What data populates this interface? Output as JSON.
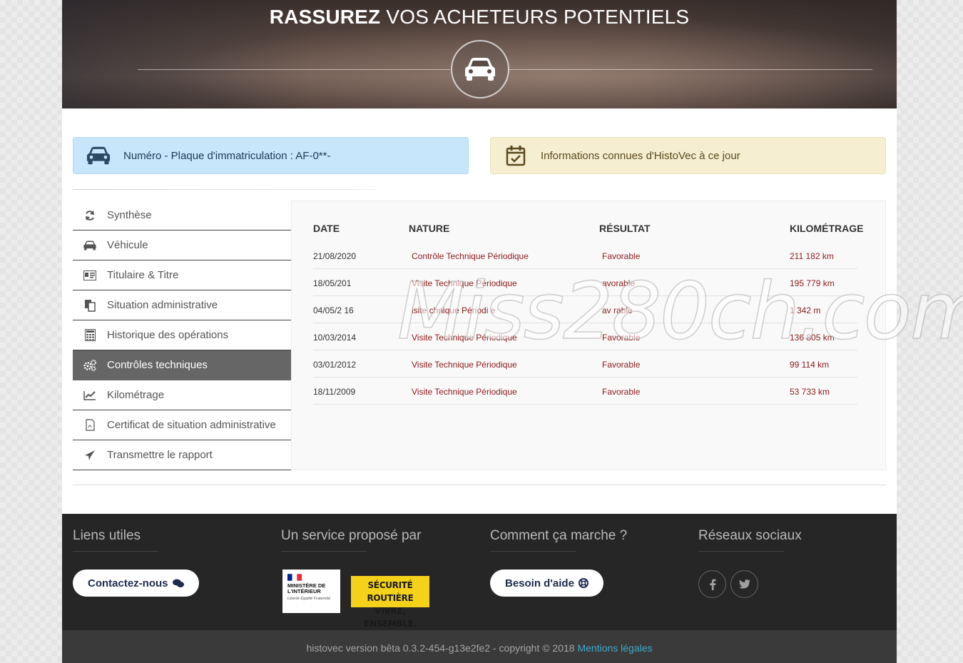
{
  "hero": {
    "title_bold": "RASSUREZ",
    "title_rest": "VOS ACHETEURS POTENTIELS"
  },
  "banners": {
    "plate": "Numéro - Plaque d'immatriculation : AF-0**-",
    "info": "Informations connues d'HistoVec à ce jour"
  },
  "menu": {
    "items": [
      {
        "label": "Synthèse",
        "icon": "refresh-icon"
      },
      {
        "label": "Véhicule",
        "icon": "car-icon"
      },
      {
        "label": "Titulaire & Titre",
        "icon": "id-card-icon"
      },
      {
        "label": "Situation administrative",
        "icon": "copy-icon"
      },
      {
        "label": "Historique des opérations",
        "icon": "calculator-icon"
      },
      {
        "label": "Contrôles techniques",
        "icon": "cogs-icon",
        "active": true
      },
      {
        "label": "Kilométrage",
        "icon": "line-chart-icon"
      },
      {
        "label": "Certificat de situation administrative",
        "icon": "pdf-icon"
      },
      {
        "label": "Transmettre le rapport",
        "icon": "send-icon"
      }
    ]
  },
  "table": {
    "headers": {
      "date": "DATE",
      "nature": "NATURE",
      "result": "RÉSULTAT",
      "km": "KILOMÉTRAGE"
    },
    "rows": [
      {
        "date": "21/08/2020",
        "nature": "Contrôle Technique Périodique",
        "result": "Favorable",
        "km": "211 182 km"
      },
      {
        "date": "18/05/201",
        "nature": "Visite Technique Périodique",
        "result": "avorable",
        "km": "195 779 km"
      },
      {
        "date": "04/05/2 16",
        "nature": "isite  chnique Périodi e",
        "result": "av rable",
        "km": "1   342  m"
      },
      {
        "date": "10/03/2014",
        "nature": "Visite Technique Périodique",
        "result": "Favorable",
        "km": "136 805 km"
      },
      {
        "date": "03/01/2012",
        "nature": "Visite Technique Périodique",
        "result": "Favorable",
        "km": "99 114 km"
      },
      {
        "date": "18/11/2009",
        "nature": "Visite Technique Périodique",
        "result": "Favorable",
        "km": "53 733 km"
      }
    ]
  },
  "watermark": "Miss280ch.com",
  "footer": {
    "col1_title": "Liens utiles",
    "contact_label": "Contactez-nous",
    "col2_title": "Un service proposé par",
    "ministry_logo_text": "MINISTÈRE DE L'INTÉRIEUR",
    "ministry_motto": "Liberté Égalité Fraternité",
    "sr_logo_line1": "SÉCURITÉ ROUTIÈRE",
    "sr_logo_line2": "VIVRE, ENSEMBLE.",
    "col3_title": "Comment ça marche ?",
    "help_label": "Besoin d'aide",
    "col4_title": "Réseaux sociaux",
    "copyright": "histovec version bêta 0.3.2-454-g13e2fe2 - copyright © 2018",
    "legal_link": "Mentions légales"
  }
}
